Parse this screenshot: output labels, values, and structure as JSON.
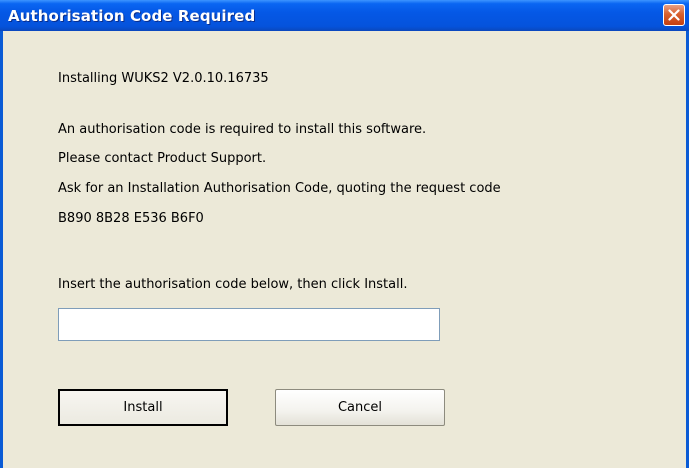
{
  "window": {
    "title": "Authorisation Code Required"
  },
  "message": {
    "installing": "Installing WUKS2 V2.0.10.16735",
    "required": "An authorisation code is required to install this software.",
    "contact": "Please contact Product Support.",
    "ask": "Ask for an Installation Authorisation Code, quoting the request code",
    "request_code": "B890 8B28 E536 B6F0",
    "instruction": "Insert the authorisation code below, then click Install."
  },
  "auth_code_input": {
    "value": "",
    "placeholder": ""
  },
  "buttons": {
    "install_label": "Install",
    "cancel_label": "Cancel"
  },
  "colors": {
    "titlebar": "#0553DC",
    "window_bg": "#ECE9D8",
    "close_button": "#D9602E"
  },
  "icons": {
    "close": "close-icon"
  }
}
